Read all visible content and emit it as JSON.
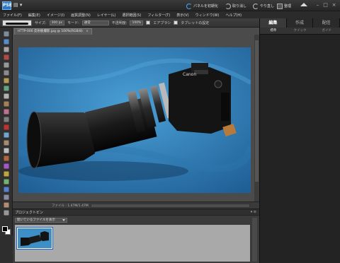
{
  "app": {
    "logo_text": "PSE",
    "logo_menu": "▤ ▾"
  },
  "titlebar": {
    "reset_panels": "パネルを初期化",
    "undo": "取り消し",
    "redo": "やり直し",
    "organizer": "整理",
    "window_controls": [
      "–",
      "□",
      "×"
    ]
  },
  "menubar": {
    "items": [
      "ファイル(F)",
      "編集(E)",
      "イメージ(I)",
      "画質調整(N)",
      "レイヤー(L)",
      "選択範囲(S)",
      "フィルター(T)",
      "表示(V)",
      "ウィンドウ(W)",
      "ヘルプ(H)"
    ]
  },
  "options": {
    "size_label": "サイズ:",
    "size_value": "300 px",
    "mode_label": "モード:",
    "mode_value": "通常",
    "opacity_label": "不透明度:",
    "opacity_value": "100%",
    "airbrush_label": "エアブラシ",
    "tablet_label": "タブレットの設定"
  },
  "document": {
    "tab_title": "HTTP-000 反射板撮影.jpg @ 100%(RGB/8)",
    "close_glyph": "×",
    "status_text": "ファイル : 1.47M/1.47M"
  },
  "right_panel": {
    "tabs": [
      "編集",
      "作成",
      "配信"
    ],
    "subtabs": [
      "標準",
      "クイック",
      "ガイド"
    ]
  },
  "project_bin": {
    "title": "プロジェクトビン",
    "controls": "▾ ≡",
    "select_value": "開いているファイルを表示"
  },
  "colors": {
    "canvas_bg": "#3e8fc6",
    "accent": "#2a78c9"
  },
  "icons": [
    "move-tool-icon",
    "zoom-tool-icon",
    "hand-tool-icon",
    "eyedropper-tool-icon",
    "marquee-tool-icon",
    "lasso-tool-icon",
    "magic-wand-tool-icon",
    "quick-selection-tool-icon",
    "type-tool-icon",
    "crop-tool-icon",
    "cookie-cutter-tool-icon",
    "straighten-tool-icon",
    "red-eye-tool-icon",
    "spot-healing-tool-icon",
    "clone-stamp-tool-icon",
    "eraser-tool-icon",
    "brush-tool-icon",
    "smart-brush-tool-icon",
    "paint-bucket-tool-icon",
    "gradient-tool-icon",
    "shape-tool-icon",
    "blur-tool-icon",
    "sponge-tool-icon",
    "pencil-tool-icon"
  ]
}
